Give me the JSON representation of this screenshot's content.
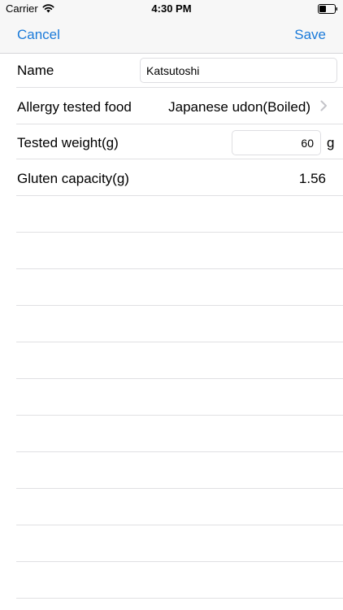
{
  "status_bar": {
    "carrier": "Carrier",
    "time": "4:30 PM"
  },
  "nav": {
    "cancel_label": "Cancel",
    "save_label": "Save"
  },
  "form": {
    "name": {
      "label": "Name",
      "value": "Katsutoshi"
    },
    "food": {
      "label": "Allergy tested food",
      "value": "Japanese udon(Boiled)"
    },
    "weight": {
      "label": "Tested weight(g)",
      "value": "60",
      "unit": "g"
    },
    "gluten": {
      "label": "Gluten capacity(g)",
      "value": "1.56"
    }
  },
  "colors": {
    "accent": "#1a7ad9",
    "separator": "#e0e0e3",
    "bar_background": "#f7f7f7"
  },
  "icons": {
    "wifi": "wifi-icon",
    "battery": "battery-icon",
    "disclosure": "chevron-right-icon"
  }
}
